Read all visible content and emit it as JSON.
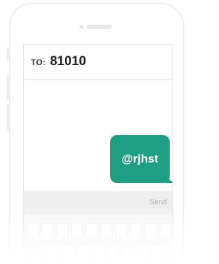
{
  "compose": {
    "to_label": "TO:",
    "recipient": "81010",
    "send_label": "Send"
  },
  "messages": [
    {
      "text": "@rjhst",
      "direction": "outgoing",
      "color": "#1f9e82"
    }
  ]
}
